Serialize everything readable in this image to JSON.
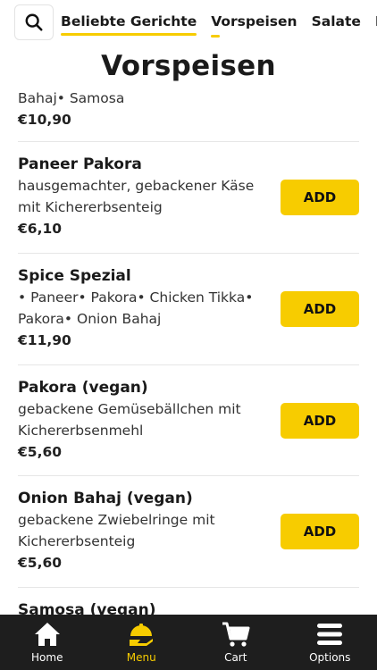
{
  "header": {
    "tabs": [
      {
        "label": "Beliebte Gerichte"
      },
      {
        "label": "Vorspeisen"
      },
      {
        "label": "Salate"
      },
      {
        "label": "In"
      }
    ]
  },
  "section": {
    "title": "Vorspeisen"
  },
  "items": [
    {
      "name": "",
      "desc": "Bahaj• Samosa",
      "price": "€10,90",
      "add_label": ""
    },
    {
      "name": "Paneer Pakora",
      "desc": "hausgemachter, gebackener Käse mit Kichererbsenteig",
      "price": "€6,10",
      "add_label": "ADD"
    },
    {
      "name": "Spice Spezial",
      "desc": "• Paneer• Pakora• Chicken Tikka• Pakora• Onion Bahaj",
      "price": "€11,90",
      "add_label": "ADD"
    },
    {
      "name": "Pakora (vegan)",
      "desc": "gebackene Gemüsebällchen mit Kichererbsenmehl",
      "price": "€5,60",
      "add_label": "ADD"
    },
    {
      "name": "Onion Bahaj (vegan)",
      "desc": "gebackene Zwiebelringe mit Kichererbsenteig",
      "price": "€5,60",
      "add_label": "ADD"
    },
    {
      "name": "Samosa (vegan)",
      "desc": "",
      "price": "",
      "add_label": ""
    }
  ],
  "bottom_nav": [
    {
      "label": "Home",
      "icon": "home-icon"
    },
    {
      "label": "Menu",
      "icon": "menu-icon"
    },
    {
      "label": "Cart",
      "icon": "cart-icon"
    },
    {
      "label": "Options",
      "icon": "options-icon"
    }
  ],
  "colors": {
    "accent": "#f7cc00",
    "nav_bg": "#1e1e1e"
  }
}
